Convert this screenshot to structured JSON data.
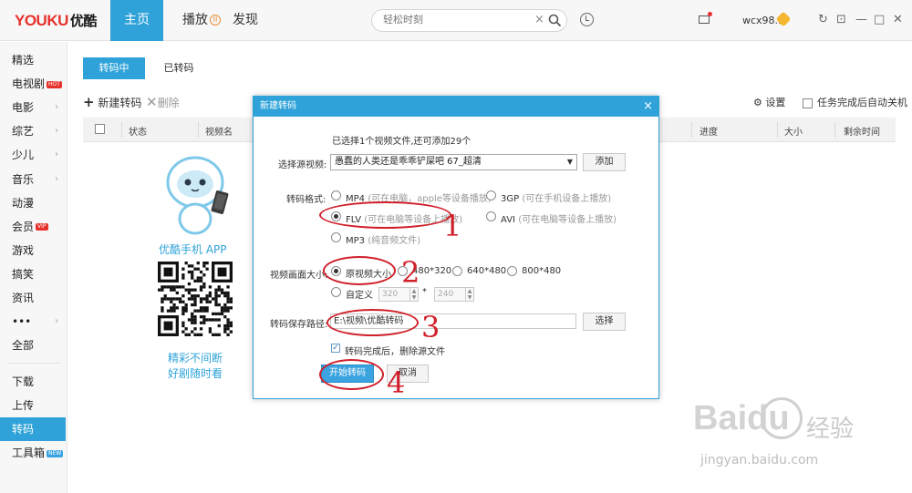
{
  "header": {
    "logo": "YOUKU",
    "logo_cn": "优酷",
    "nav": [
      "主页",
      "播放",
      "发现"
    ],
    "play_icon": "II",
    "search_placeholder": "轻松时刻",
    "search_clear": "×",
    "username": "wcx98...",
    "window_controls": [
      "↻",
      "⊡",
      "—",
      "□",
      "✕"
    ]
  },
  "sidebar": {
    "items": [
      {
        "label": "精选",
        "arrow": ""
      },
      {
        "label": "电视剧",
        "badge": "HOT",
        "arrow": ""
      },
      {
        "label": "电影",
        "arrow": "›"
      },
      {
        "label": "综艺",
        "arrow": "›"
      },
      {
        "label": "少儿",
        "arrow": "›"
      },
      {
        "label": "音乐",
        "arrow": "›"
      },
      {
        "label": "动漫",
        "arrow": ""
      },
      {
        "label": "会员",
        "badge": "VIP",
        "arrow": ""
      },
      {
        "label": "游戏",
        "arrow": ""
      },
      {
        "label": "搞笑",
        "arrow": ""
      },
      {
        "label": "资讯",
        "arrow": ""
      },
      {
        "label": "•••",
        "arrow": "›"
      },
      {
        "label": "全部",
        "arrow": ""
      }
    ],
    "bottom": [
      {
        "label": "下载"
      },
      {
        "label": "上传"
      },
      {
        "label": "转码",
        "active": true
      },
      {
        "label": "工具箱",
        "badge": "NEW"
      }
    ]
  },
  "content": {
    "tabs": [
      "转码中",
      "已转码"
    ],
    "new_button": "新建转码",
    "delete_button": "删除",
    "settings": "设置",
    "auto_shutdown": "任务完成后自动关机",
    "columns": [
      "状态",
      "视频名",
      "进度",
      "大小",
      "剩余时间"
    ],
    "app_label": "优酷手机 APP",
    "slogan_1": "精彩不间断",
    "slogan_2": "好剧随时看"
  },
  "dialog": {
    "title": "新建转码",
    "close": "×",
    "info": "已选择1个视频文件,还可添加29个",
    "source_label": "选择源视频:",
    "source_value": "愚蠢的人类还是乖乖铲屎吧 67_超清",
    "add_button": "添加",
    "format_label": "转码格式:",
    "formats": [
      {
        "name": "MP4",
        "hint": "(可在电脑，apple等设备播放)",
        "selected": false
      },
      {
        "name": "3GP",
        "hint": "(可在手机设备上播放)",
        "selected": false
      },
      {
        "name": "FLV",
        "hint": "(可在电脑等设备上播放)",
        "selected": true
      },
      {
        "name": "AVI",
        "hint": "(可在电脑等设备上播放)",
        "selected": false
      },
      {
        "name": "MP3",
        "hint": "(纯音频文件)",
        "selected": false
      }
    ],
    "size_label": "视频画面大小:",
    "sizes": [
      "原视频大小",
      "480*320",
      "640*480",
      "800*480"
    ],
    "custom_label": "自定义",
    "custom_width": "320",
    "custom_height": "240",
    "custom_sep": "*",
    "path_label": "转码保存路径:",
    "path_value": "E:\\视频\\优酷转码",
    "choose_button": "选择",
    "delete_source": "转码完成后，删除源文件",
    "start_button": "开始转码",
    "cancel_button": "取消"
  },
  "annotations": [
    "1",
    "2",
    "3",
    "4"
  ],
  "watermark": {
    "text": "Baidu",
    "cn": "经验",
    "url": "jingyan.baidu.com"
  },
  "colors": {
    "accent": "#2fa3d9",
    "annotation": "#d0202a",
    "logo_red": "#e6312c"
  }
}
